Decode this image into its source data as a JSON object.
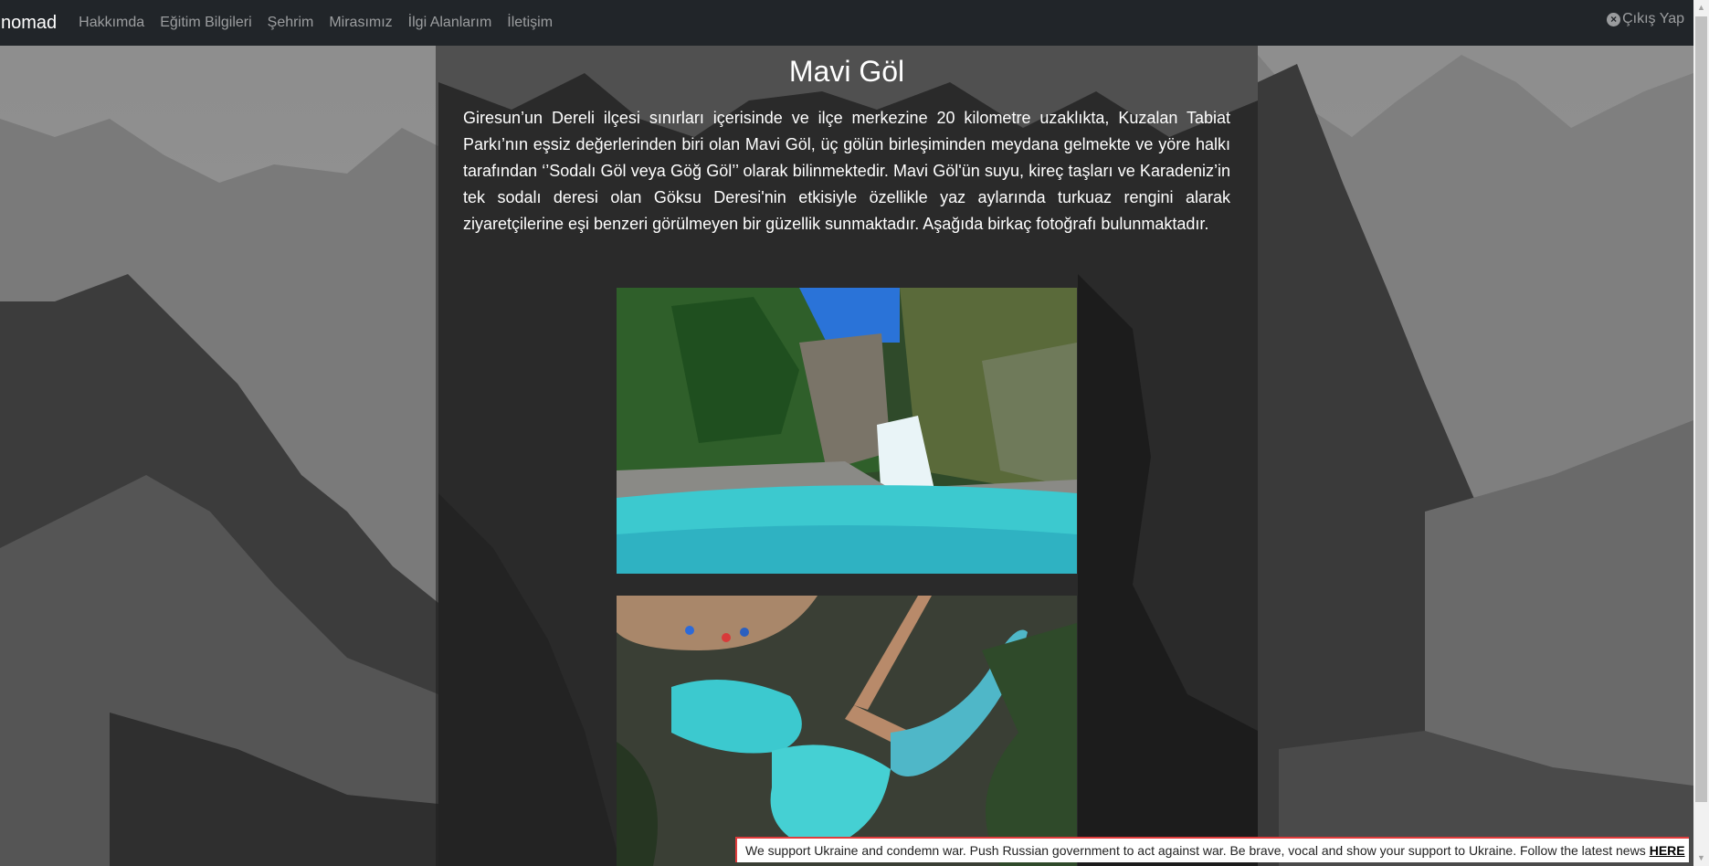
{
  "navbar": {
    "brand": "nomad",
    "links": [
      "Hakkımda",
      "Eğitim Bilgileri",
      "Şehrim",
      "Mirasımız",
      "İlgi Alanlarım",
      "İletişim"
    ],
    "logout_label": "Çıkış Yap",
    "logout_icon": "close-circle-icon"
  },
  "main": {
    "title": "Mavi Göl",
    "description": "Giresun’un Dereli ilçesi sınırları içerisinde ve ilçe merkezine 20 kilometre uzaklıkta, Kuzalan Tabiat Parkı’nın eşsiz değerlerinden biri olan Mavi Göl, üç gölün birleşiminden meydana gelmekte ve yöre halkı tarafından ‘’Sodalı Göl veya Göğ Göl’’ olarak bilinmektedir. Mavi Göl'ün suyu, kireç taşları ve Karadeniz’in tek sodalı deresi olan Göksu Deresi'nin etkisiyle özellikle yaz aylarında turkuaz rengini alarak ziyaretçilerine eşi benzeri görülmeyen bir güzellik sunmaktadır. Aşağıda birkaç fotoğrafı bulunmaktadır."
  },
  "banner": {
    "text": "We support Ukraine and condemn war. Push Russian government to act against war. Be brave, vocal and show your support to Ukraine. Follow the latest news",
    "link_label": "HERE"
  },
  "colors": {
    "navbar_bg": "#212529",
    "lake_turquoise": "#3cc9cf",
    "banner_border": "#e03c3c"
  }
}
